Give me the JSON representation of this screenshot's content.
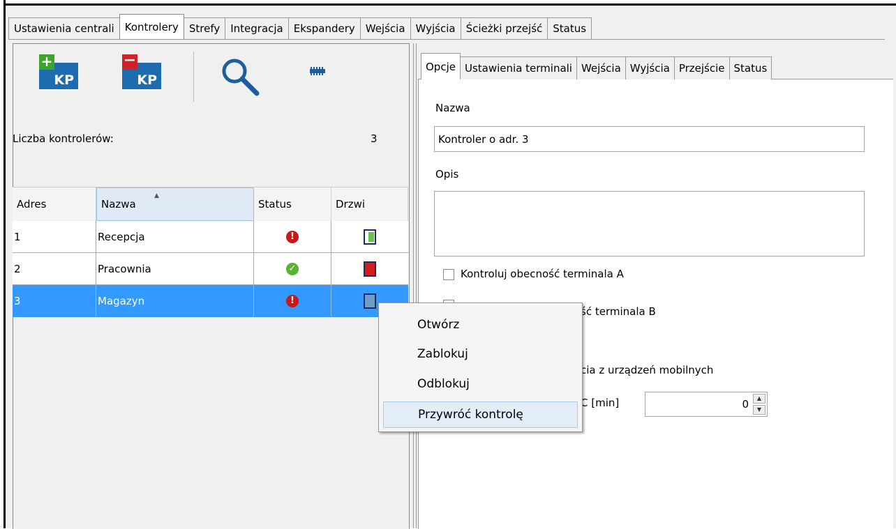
{
  "top_tabs": [
    "Ustawienia centrali",
    "Kontrolery",
    "Strefy",
    "Integracja",
    "Ekspandery",
    "Wejścia",
    "Wyjścia",
    "Ścieżki przejść",
    "Status"
  ],
  "top_tabs_active": "Kontrolery",
  "toolbar": {
    "add_label": "KP",
    "remove_label": "KP",
    "add_icon": "add-controller-icon",
    "remove_icon": "remove-controller-icon",
    "search_icon": "search-icon",
    "keypad_icon": "keypad-icon"
  },
  "controllers_count": {
    "label": "Liczba kontrolerów:",
    "value": "3"
  },
  "grid": {
    "columns": [
      "Adres",
      "Nazwa",
      "Status",
      "Drzwi"
    ],
    "rows": [
      {
        "address": "1",
        "name": "Recepcja",
        "status": "error",
        "door": "open"
      },
      {
        "address": "2",
        "name": "Pracownia",
        "status": "ok",
        "door": "locked"
      },
      {
        "address": "3",
        "name": "Magazyn",
        "status": "error",
        "door": "unknown",
        "selected": true
      }
    ]
  },
  "right_tabs": [
    "Opcje",
    "Ustawienia terminali",
    "Wejścia",
    "Wyjścia",
    "Przejście",
    "Status"
  ],
  "right_tabs_active": "Opcje",
  "form": {
    "name_label": "Nazwa",
    "name_value": "Kontroler o adr. 3",
    "desc_label": "Opis",
    "desc_value": "",
    "check_a": "Kontroluj obecność terminala A",
    "check_b_partial": "ść terminala B",
    "mobile_partial": "cia z urządzeń mobilnych",
    "time_partial": "C [min]",
    "time_value": "0"
  },
  "context_menu": {
    "items": [
      "Otwórz",
      "Zablokuj",
      "Odblokuj",
      "Przywróć kontrolę"
    ],
    "highlighted": "Przywróć kontrolę"
  },
  "colors": {
    "selection": "#3399ff",
    "kp_blue": "#1e6bb0",
    "add_green": "#3fa42d",
    "remove_red": "#d0202a"
  }
}
